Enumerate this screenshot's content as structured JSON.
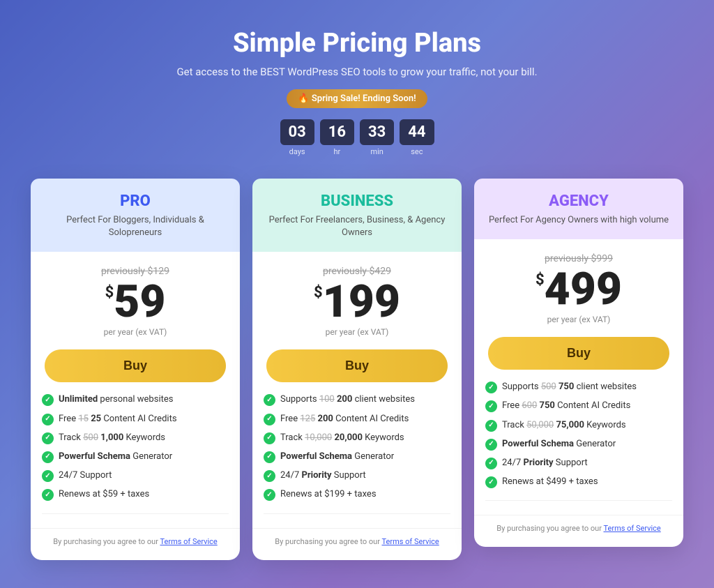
{
  "header": {
    "title": "Simple Pricing Plans",
    "subtitle": "Get access to the BEST WordPress SEO tools to grow your traffic, not your bill.",
    "sale_badge": "🔥 Spring Sale! Ending Soon!",
    "countdown": {
      "days": "03",
      "hours": "16",
      "minutes": "33",
      "seconds": "44",
      "days_label": "days",
      "hours_label": "hr",
      "minutes_label": "min",
      "seconds_label": "sec"
    }
  },
  "plans": [
    {
      "id": "pro",
      "name": "PRO",
      "name_class": "pro",
      "header_class": "pro",
      "desc": "Perfect For Bloggers, Individuals & Solopreneurs",
      "old_price": "previously $129",
      "price": "59",
      "period": "per year (ex VAT)",
      "buy_label": "Buy",
      "features": [
        {
          "text": "Unlimited personal websites",
          "bold_part": "Unlimited"
        },
        {
          "text": "Free 15 25 Content AI Credits",
          "strike": "15",
          "new_val": "25",
          "prefix": "Free ",
          "suffix": " Content AI Credits"
        },
        {
          "text": "Track 500 1,000 Keywords",
          "strike": "500",
          "new_val": "1,000",
          "prefix": "Track ",
          "suffix": " Keywords"
        },
        {
          "text": "Powerful Schema Generator",
          "bold_part": "Powerful Schema"
        },
        {
          "text": "24/7 Support"
        },
        {
          "text": "Renews at $59 + taxes"
        }
      ],
      "tos_text": "By purchasing you agree to our ",
      "tos_link": "Terms of Service"
    },
    {
      "id": "business",
      "name": "BUSINESS",
      "name_class": "business",
      "header_class": "business",
      "desc": "Perfect For Freelancers, Business, & Agency Owners",
      "old_price": "previously $429",
      "price": "199",
      "period": "per year (ex VAT)",
      "buy_label": "Buy",
      "features": [
        {
          "text": "Supports 100 200 client websites",
          "strike": "100",
          "new_val": "200",
          "prefix": "Supports ",
          "suffix": " client websites"
        },
        {
          "text": "Free 125 200 Content AI Credits",
          "strike": "125",
          "new_val": "200",
          "prefix": "Free ",
          "suffix": " Content AI Credits"
        },
        {
          "text": "Track 10,000 20,000 Keywords",
          "strike": "10,000",
          "new_val": "20,000",
          "prefix": "Track ",
          "suffix": " Keywords"
        },
        {
          "text": "Powerful Schema Generator",
          "bold_part": "Powerful Schema"
        },
        {
          "text": "24/7 Priority Support",
          "bold_part": "Priority"
        },
        {
          "text": "Renews at $199 + taxes"
        }
      ],
      "tos_text": "By purchasing you agree to our ",
      "tos_link": "Terms of Service"
    },
    {
      "id": "agency",
      "name": "AGENCY",
      "name_class": "agency",
      "header_class": "agency",
      "desc": "Perfect For Agency Owners with high volume",
      "old_price": "previously $999",
      "price": "499",
      "period": "per year (ex VAT)",
      "buy_label": "Buy",
      "features": [
        {
          "text": "Supports 500 750 client websites",
          "strike": "500",
          "new_val": "750",
          "prefix": "Supports ",
          "suffix": " client websites"
        },
        {
          "text": "Free 600 750 Content AI Credits",
          "strike": "600",
          "new_val": "750",
          "prefix": "Free ",
          "suffix": " Content AI Credits"
        },
        {
          "text": "Track 50,000 75,000 Keywords",
          "strike": "50,000",
          "new_val": "75,000",
          "prefix": "Track ",
          "suffix": " Keywords"
        },
        {
          "text": "Powerful Schema Generator",
          "bold_part": "Powerful Schema"
        },
        {
          "text": "24/7 Priority Support",
          "bold_part": "Priority"
        },
        {
          "text": "Renews at $499 + taxes"
        }
      ],
      "tos_text": "By purchasing you agree to our ",
      "tos_link": "Terms of Service"
    }
  ]
}
